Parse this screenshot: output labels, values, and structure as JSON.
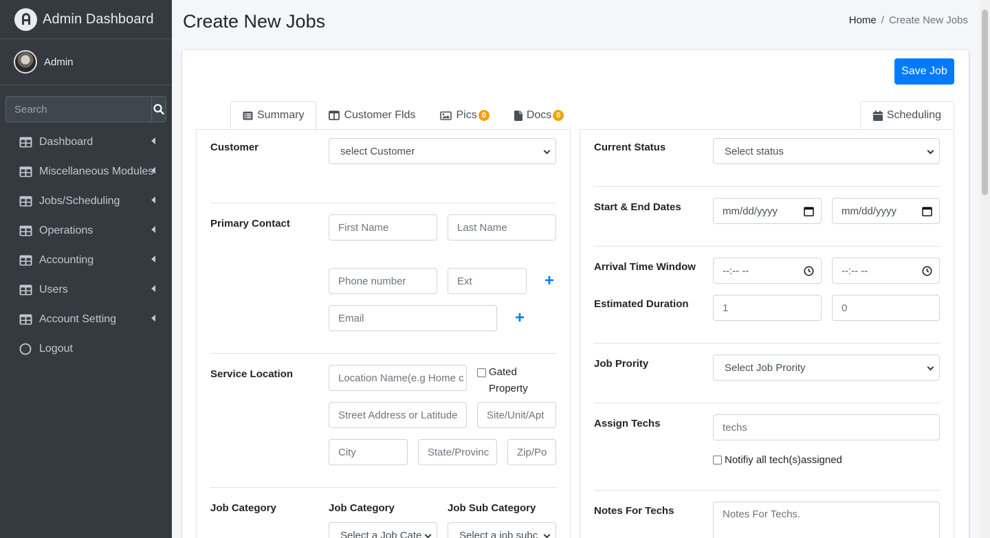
{
  "sidebar": {
    "brand": "Admin Dashboard",
    "user": "Admin",
    "search_placeholder": "Search",
    "items": [
      {
        "label": "Dashboard"
      },
      {
        "label": "Miscellaneous Modules"
      },
      {
        "label": "Jobs/Scheduling"
      },
      {
        "label": "Operations"
      },
      {
        "label": "Accounting"
      },
      {
        "label": "Users"
      },
      {
        "label": "Account Setting"
      },
      {
        "label": "Logout"
      }
    ]
  },
  "header": {
    "title": "Create New Jobs",
    "breadcrumb_home": "Home",
    "breadcrumb_sep": "/",
    "breadcrumb_current": "Create New Jobs"
  },
  "toolbar": {
    "save_label": "Save Job"
  },
  "tabs": {
    "summary": "Summary",
    "customer_flds": "Customer Flds",
    "pics": "Pics",
    "pics_count": "0",
    "docs": "Docs",
    "docs_count": "0",
    "scheduling": "Scheduling"
  },
  "left": {
    "customer_label": "Customer",
    "customer_select": "select Customer",
    "primary_contact_label": "Primary Contact",
    "first_name_placeholder": "First Name",
    "last_name_placeholder": "Last Name",
    "phone_placeholder": "Phone number",
    "ext_placeholder": "Ext",
    "email_placeholder": "Email",
    "plus": "+",
    "service_location_label": "Service Location",
    "location_name_placeholder": "Location Name(e.g Home c",
    "gated_property": "Gated Property",
    "street_placeholder": "Street Address or Latitude",
    "site_placeholder": "Site/Unit/Apt",
    "city_placeholder": "City",
    "state_placeholder": "State/Provinc",
    "zip_placeholder": "Zip/Po",
    "job_category_label": "Job Category",
    "job_category_col": "Job Category",
    "job_sub_category_col": "Job Sub Category",
    "job_category_select": "Select a Job Cate",
    "job_sub_category_select": "Select a job subc"
  },
  "right": {
    "current_status_label": "Current Status",
    "status_select": "Select status",
    "dates_label": "Start & End Dates",
    "date_placeholder": "mm/dd/yyyy",
    "arrival_label": "Arrival Time Window",
    "time_placeholder": "--:-- --",
    "duration_label": "Estimated Duration",
    "duration_hours": "1",
    "duration_minutes": "0",
    "priority_label": "Job Prority",
    "priority_select": "Select Job Prority",
    "assign_label": "Assign Techs",
    "techs_placeholder": "techs",
    "notify_label": "Notifiy all tech(s)assigned",
    "notes_label": "Notes For Techs",
    "notes_placeholder": "Notes For Techs."
  }
}
